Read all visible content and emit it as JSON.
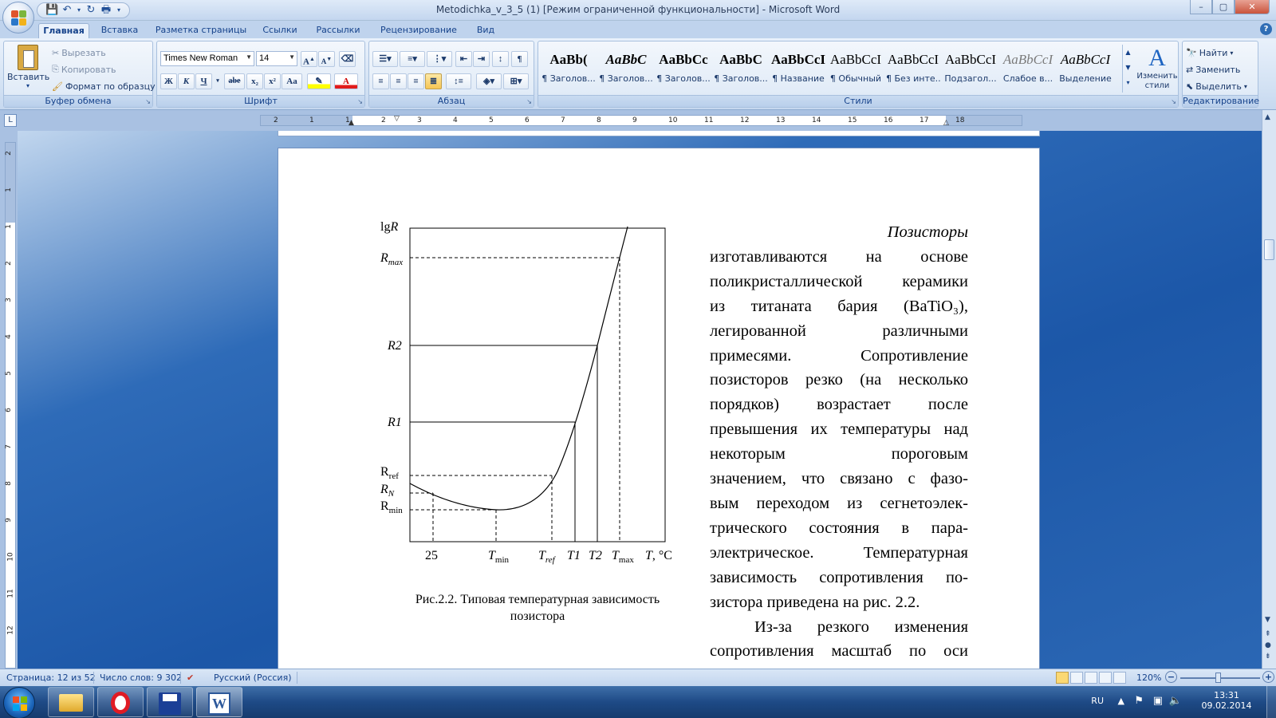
{
  "window": {
    "title": "Metodichka_v_3_5 (1) [Режим ограниченной функциональности] - Microsoft Word",
    "controls": {
      "minimize": "–",
      "maximize": "▢",
      "close": "✕"
    }
  },
  "quick_access": [
    {
      "name": "save-icon",
      "glyph": "💾"
    },
    {
      "name": "undo-icon",
      "glyph": "↶"
    },
    {
      "name": "redo-icon",
      "glyph": "↻"
    },
    {
      "name": "print-preview-icon",
      "glyph": "🖶"
    },
    {
      "name": "customize-icon",
      "glyph": "▾"
    }
  ],
  "tabs": [
    "Главная",
    "Вставка",
    "Разметка страницы",
    "Ссылки",
    "Рассылки",
    "Рецензирование",
    "Вид"
  ],
  "active_tab": "Главная",
  "ribbon": {
    "clipboard": {
      "label": "Буфер обмена",
      "paste": "Вставить",
      "cut": "Вырезать",
      "copy": "Копировать",
      "format_painter": "Формат по образцу"
    },
    "font": {
      "label": "Шрифт",
      "font_name": "Times New Roman",
      "font_size": "14",
      "grow": "A",
      "shrink": "A",
      "bold": "Ж",
      "italic": "К",
      "underline": "Ч",
      "strike": "abe",
      "subscript": "x₂",
      "superscript": "x²",
      "change_case": "Aa",
      "font_color": "A"
    },
    "paragraph": {
      "label": "Абзац",
      "show_marks": "¶"
    },
    "styles": {
      "label": "Стили",
      "items": [
        {
          "preview": "AaBb(",
          "name": "¶ Заголов...",
          "bold": true
        },
        {
          "preview": "AaBbC",
          "name": "¶ Заголов...",
          "bold": true,
          "italic": true
        },
        {
          "preview": "AaBbCc",
          "name": "¶ Заголов...",
          "bold": true
        },
        {
          "preview": "AaBbC",
          "name": "¶ Заголов...",
          "bold": true
        },
        {
          "preview": "AaBbCcI",
          "name": "¶ Название",
          "bold": true
        },
        {
          "preview": "AaBbCcI",
          "name": "¶ Обычный"
        },
        {
          "preview": "AaBbCcI",
          "name": "¶ Без инте..."
        },
        {
          "preview": "AaBbCcI",
          "name": "Подзагол..."
        },
        {
          "preview": "AaBbCcI",
          "name": "Слабое в...",
          "italic": true,
          "muted": true
        },
        {
          "preview": "AaBbCcI",
          "name": "Выделение",
          "italic": true
        }
      ],
      "change_styles": "Изменить стили"
    },
    "editing": {
      "label": "Редактирование",
      "find": "Найти",
      "replace": "Заменить",
      "select": "Выделить"
    }
  },
  "ruler": {
    "h_numbers": [
      "2",
      "1",
      "1",
      "2",
      "3",
      "4",
      "5",
      "6",
      "7",
      "8",
      "9",
      "10",
      "11",
      "12",
      "13",
      "14",
      "15",
      "16",
      "17",
      "18"
    ],
    "v_numbers": [
      "2",
      "1",
      "1",
      "2",
      "3",
      "4",
      "5",
      "6",
      "7",
      "8",
      "9",
      "10",
      "11",
      "12"
    ]
  },
  "document": {
    "figure": {
      "y_axis_label": "lgR",
      "y_labels": [
        "Rmax",
        "R2",
        "R1",
        "Rref",
        "RN",
        "Rmin"
      ],
      "x_labels": [
        "25",
        "Tmin",
        "Tref",
        "T1",
        "T2",
        "Tmax",
        "T, °C"
      ],
      "caption_line1": "Рис.2.2. Типовая температурная зависимость",
      "caption_line2": "позистора"
    },
    "paragraph1_lines": [
      "Позисторы",
      "изготавливаются на основе",
      "поликристаллической керамики",
      "из титаната бария (BaTiO₃),",
      "легированной различными",
      "примесями. Сопротивление",
      "позисторов резко (на несколько",
      "порядков) возрастает после",
      "превышения их температуры над",
      "некоторым пороговым",
      "значением, что связано с фазо-",
      "вым переходом из сегнетоэлек-",
      "трического состояния в пара-",
      "электрическое. Температурная",
      "зависимость сопротивления по-",
      "зистора приведена на рис. 2.2."
    ],
    "paragraph2_lines": [
      "Из-за резкого изменения",
      "сопротивления масштаб по оси"
    ]
  },
  "status": {
    "page": "Страница: 12 из 52",
    "words": "Число слов: 9 302",
    "language": "Русский (Россия)",
    "zoom": "120%",
    "zoom_minus": "−",
    "zoom_plus": "+"
  },
  "taskbar": {
    "items": [
      "file-explorer-icon",
      "opera-icon",
      "save-app-icon",
      "word-icon"
    ],
    "lang": "RU",
    "time": "13:31",
    "date": "09.02.2014"
  }
}
